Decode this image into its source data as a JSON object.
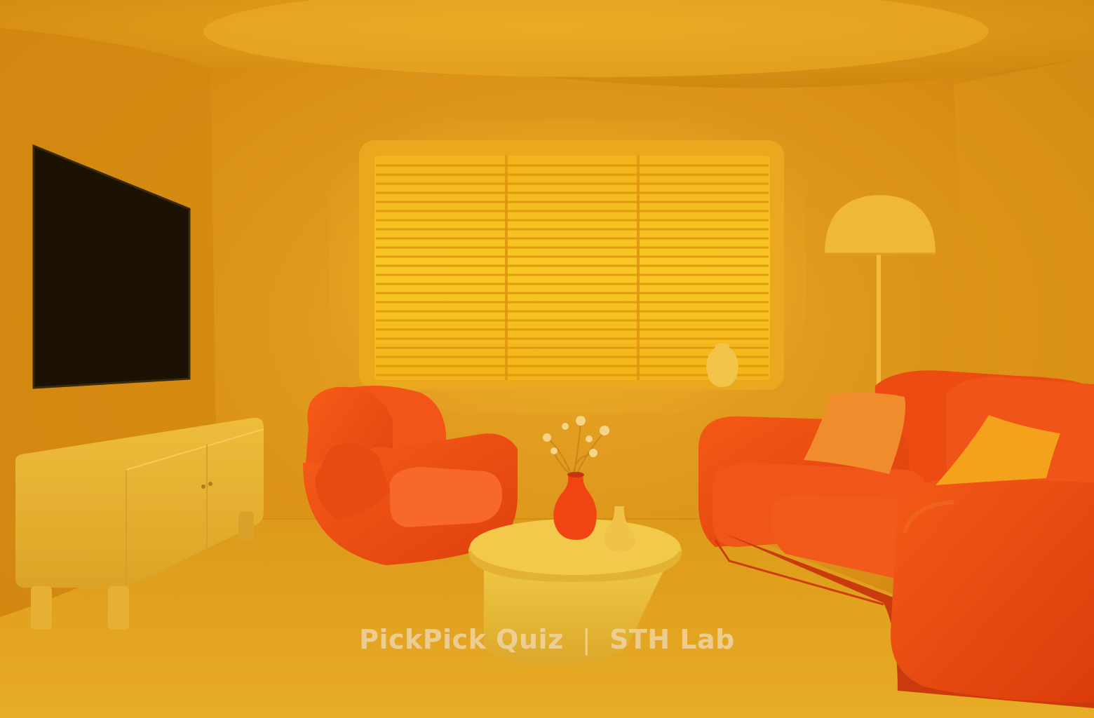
{
  "watermark": {
    "left_text": "PickPick Quiz",
    "separator": "|",
    "right_text": "STH Lab"
  },
  "scene": {
    "description_items": [
      "tv-icon",
      "window-blinds",
      "floor-lamp",
      "armchair",
      "sofa",
      "coffee-table",
      "vase",
      "flowers",
      "tv-console",
      "cushion"
    ],
    "colors": {
      "wall": "#d88c12",
      "wall_light": "#e6a41e",
      "ceiling": "#e09a16",
      "floor": "#e1a11c",
      "window_glow": "#f7c21e",
      "blind_line": "#e19a10",
      "tv": "#1b1204",
      "console": "#e8b231",
      "armchair": "#f04a12",
      "sofa": "#ee4a10",
      "sofa_shadow": "#c93a0c",
      "cushion": "#f08c2c",
      "cushion_yellow": "#f4a21c",
      "table": "#ecc03a",
      "lamp": "#f0b838",
      "vase_red": "#f04412",
      "vase_yellow": "#f1c24a"
    }
  }
}
